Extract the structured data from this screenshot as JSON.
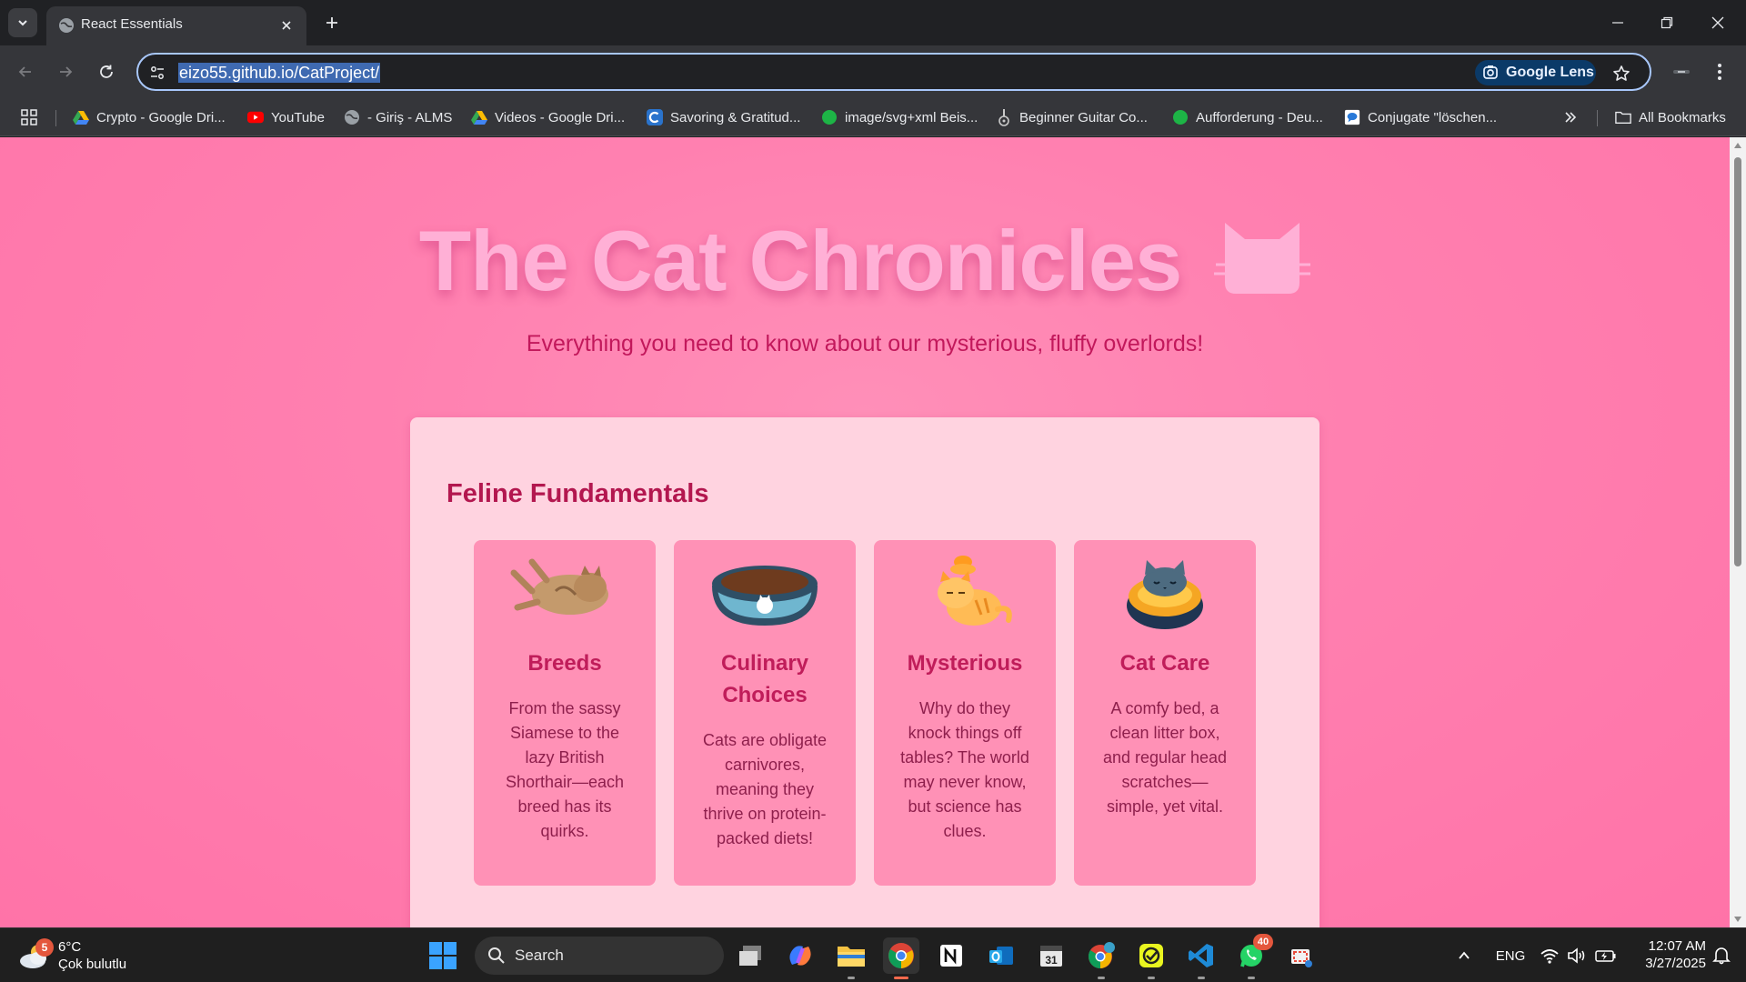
{
  "browser": {
    "tab": {
      "title": "React Essentials"
    },
    "url": "eizo55.github.io/CatProject/",
    "lens_label": "Google Lens",
    "bookmarks": [
      {
        "label": "Crypto - Google Dri...",
        "icon": "google-drive-icon"
      },
      {
        "label": "YouTube",
        "icon": "youtube-icon"
      },
      {
        "label": "- Giriş - ALMS",
        "icon": "globe-icon"
      },
      {
        "label": "Videos - Google Dri...",
        "icon": "google-drive-icon"
      },
      {
        "label": "Savoring & Gratitud...",
        "icon": "coursera-icon"
      },
      {
        "label": "image/svg+xml Beis...",
        "icon": "green-dot-icon"
      },
      {
        "label": "Beginner Guitar Co...",
        "icon": "guitar-icon"
      },
      {
        "label": "Aufforderung - Deu...",
        "icon": "green-dot-icon"
      },
      {
        "label": "Conjugate \"löschen...",
        "icon": "chat-bubble-icon"
      }
    ],
    "all_bookmarks_label": "All Bookmarks"
  },
  "page": {
    "title": "The Cat Chronicles",
    "subtitle": "Everything you need to know about our mysterious, fluffy overlords!",
    "section_title": "Feline Fundamentals",
    "features": [
      {
        "title": "Breeds",
        "description": "From the sassy Siamese to the lazy British Shorthair—each breed has its quirks.",
        "icon": "lying-cat-icon"
      },
      {
        "title": "Culinary Choices",
        "description": "Cats are obligate carnivores, meaning they thrive on protein-packed diets!",
        "icon": "food-bowl-icon"
      },
      {
        "title": "Mysterious",
        "description": "Why do they knock things off tables? The world may never know, but science has clues.",
        "icon": "sleepy-cat-icon"
      },
      {
        "title": "Cat Care",
        "description": "A comfy bed, a clean litter box, and regular head scratches—simple, yet vital.",
        "icon": "cat-bed-icon"
      }
    ],
    "colors": {
      "background": "#ff80b0",
      "card": "#ffd3e0",
      "feature_card": "#ff91b6",
      "heading": "#c01d5a"
    }
  },
  "taskbar": {
    "weather": {
      "temp": "6°C",
      "condition": "Çok bulutlu",
      "badge": "5"
    },
    "search_label": "Search",
    "whatsapp_badge": "40",
    "language": "ENG",
    "time": "12:07 AM",
    "date": "3/27/2025"
  }
}
